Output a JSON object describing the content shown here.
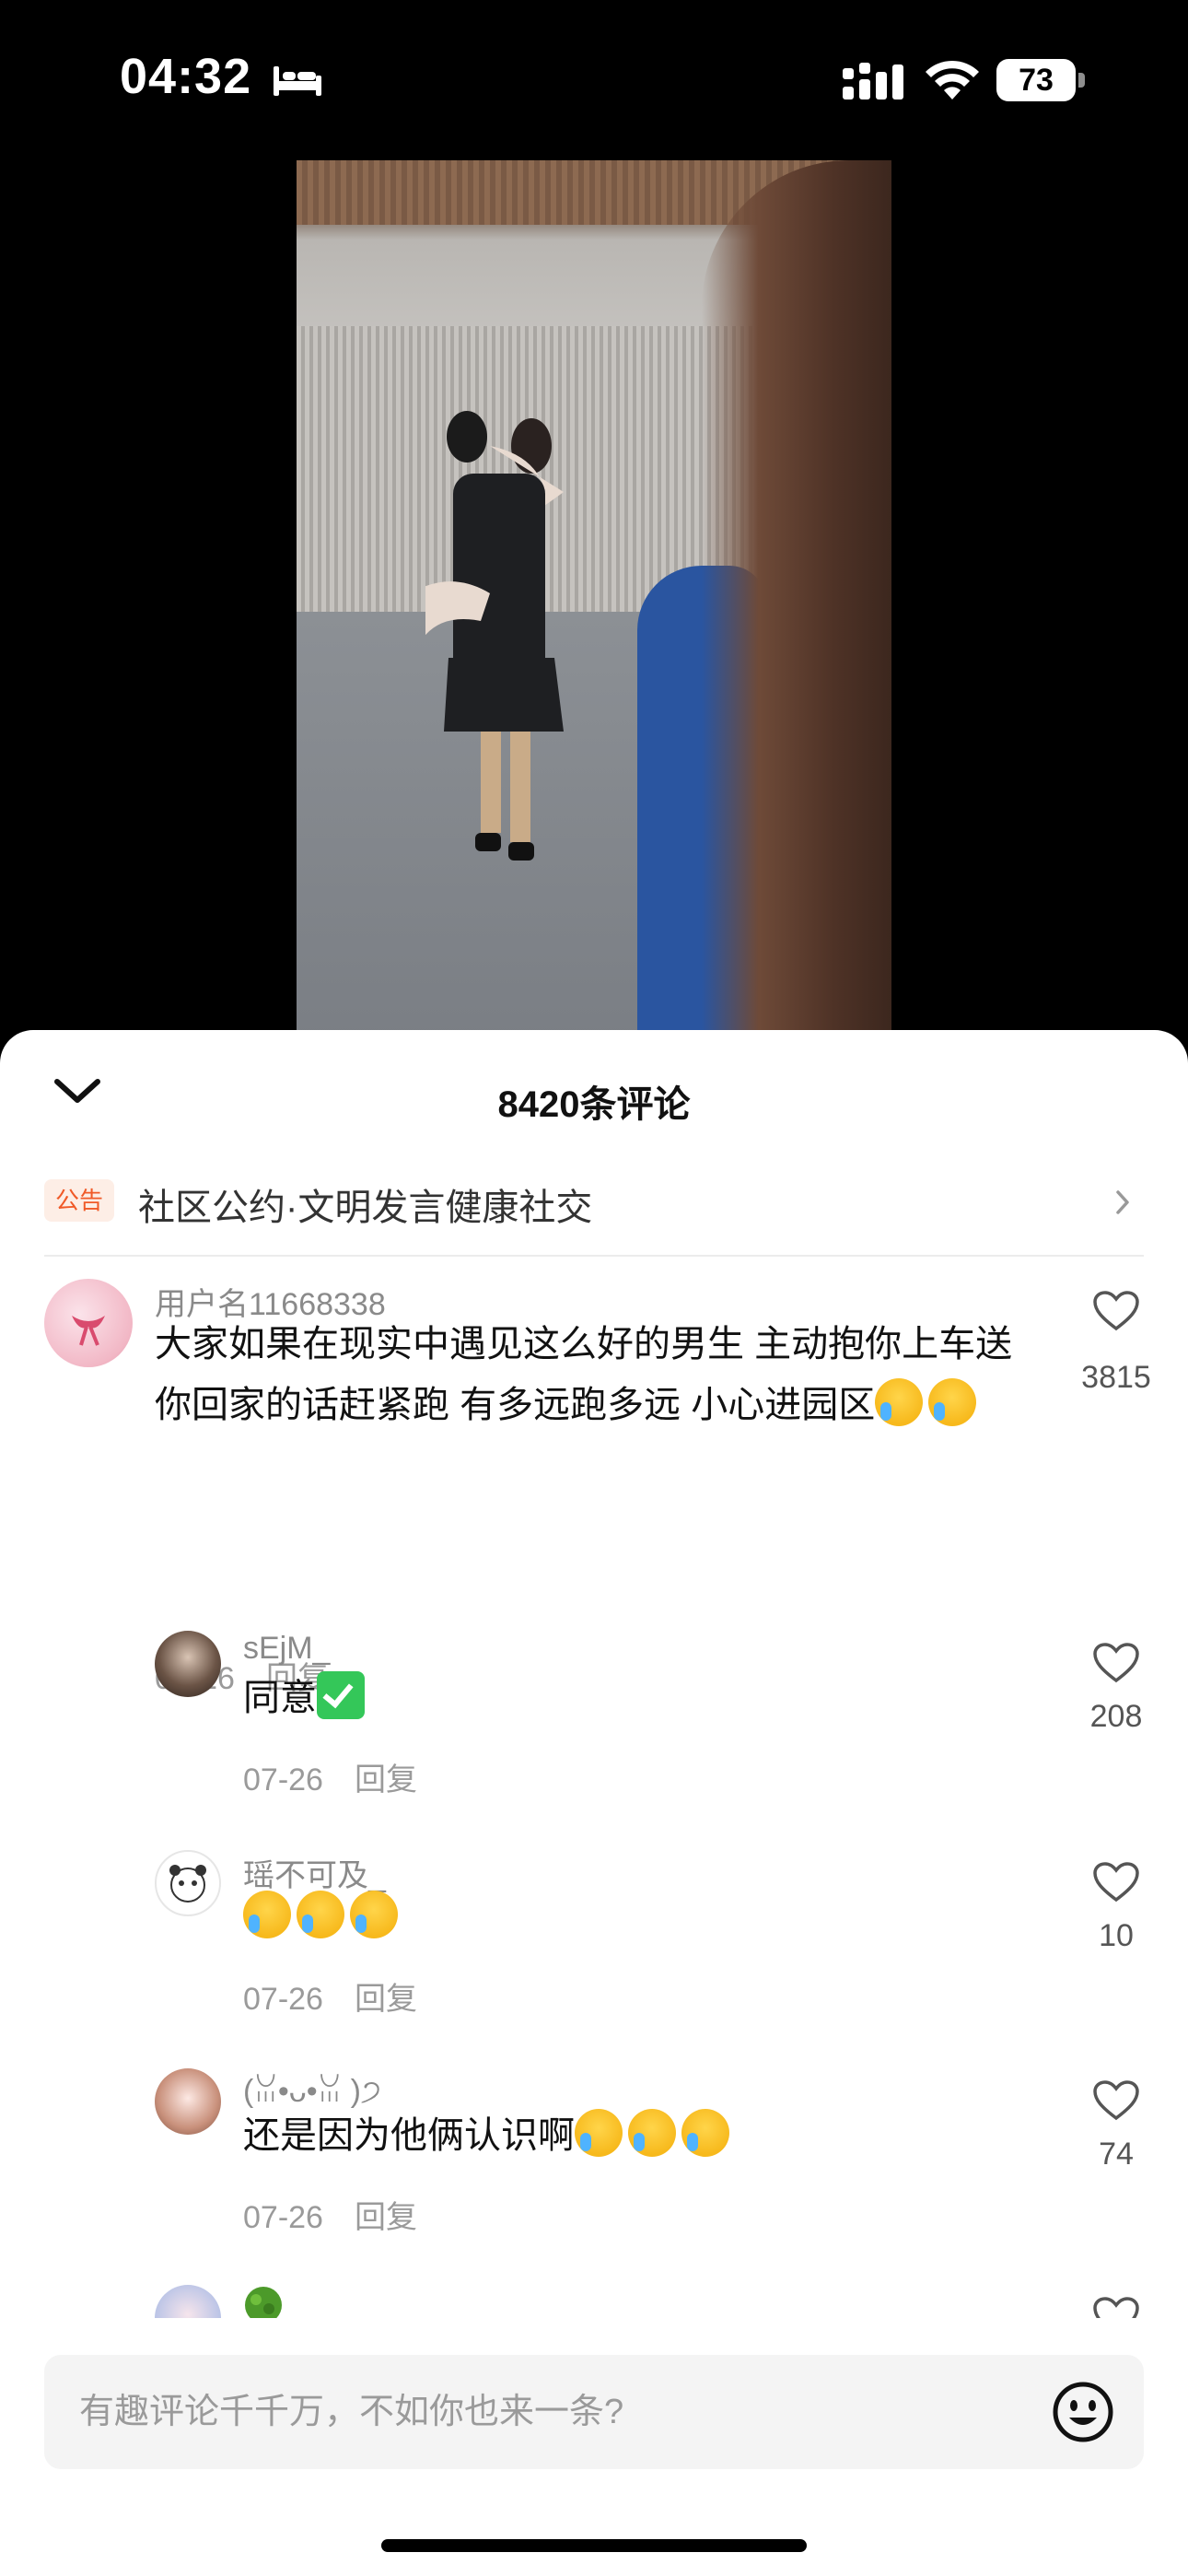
{
  "status_bar": {
    "time": "04:32",
    "battery": "73"
  },
  "sheet": {
    "title": "8420条评论",
    "notice": {
      "badge": "公告",
      "text": "社区公约·文明发言健康社交"
    }
  },
  "comments": [
    {
      "username": "用户名11668338",
      "text": "大家如果在现实中遇见这么好的男生 主动抱你上车送你回家的话赶紧跑 有多远跑多远 小心进园区",
      "emojis": [
        "loudly-crying-face",
        "loudly-crying-face"
      ],
      "date": "07-26",
      "reply_label": "回复",
      "likes": "3815"
    },
    {
      "username": "sEjM_",
      "text": "同意",
      "emojis": [
        "check-mark-button"
      ],
      "date": "07-26",
      "reply_label": "回复",
      "likes": "208"
    },
    {
      "username": "瑶不可及_",
      "text": "",
      "emojis": [
        "loudly-crying-face",
        "loudly-crying-face",
        "loudly-crying-face"
      ],
      "date": "07-26",
      "reply_label": "回复",
      "likes": "10"
    },
    {
      "username": "(ꈍ•ᴗ•ꈍ )੭",
      "text": "还是因为他俩认识啊",
      "emojis": [
        "loudly-crying-face",
        "loudly-crying-face",
        "loudly-crying-face"
      ],
      "date": "07-26",
      "reply_label": "回复",
      "likes": "74"
    }
  ],
  "input": {
    "placeholder": "有趣评论千千万，不如你也来一条?"
  },
  "colors": {
    "accent": "#f05a28",
    "sheet_bg": "#ffffff",
    "video_bg": "#000000"
  }
}
